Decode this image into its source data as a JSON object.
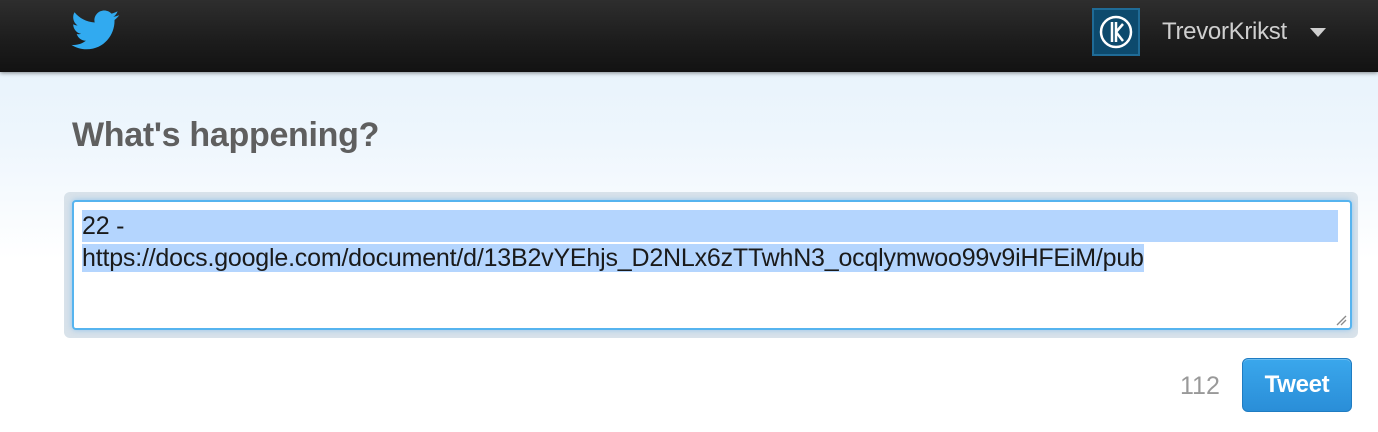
{
  "topbar": {
    "logo_icon": "twitter-bird-icon",
    "avatar_icon": "tk-avatar",
    "username": "TrevorKrikst",
    "menu_icon": "caret-down-icon"
  },
  "composer": {
    "heading": "What's happening?",
    "text_line1": "22 -",
    "text_line2": "https://docs.google.com/document/d/13B2vYEhjs_D2NLx6zTTwhN3_ocqlymwoo99v9iHFEiM/pub",
    "char_count": "112",
    "tweet_label": "Tweet"
  },
  "colors": {
    "accent": "#2a8ed8",
    "focus_border": "#56b4ef",
    "selection": "#b4d5fe"
  }
}
